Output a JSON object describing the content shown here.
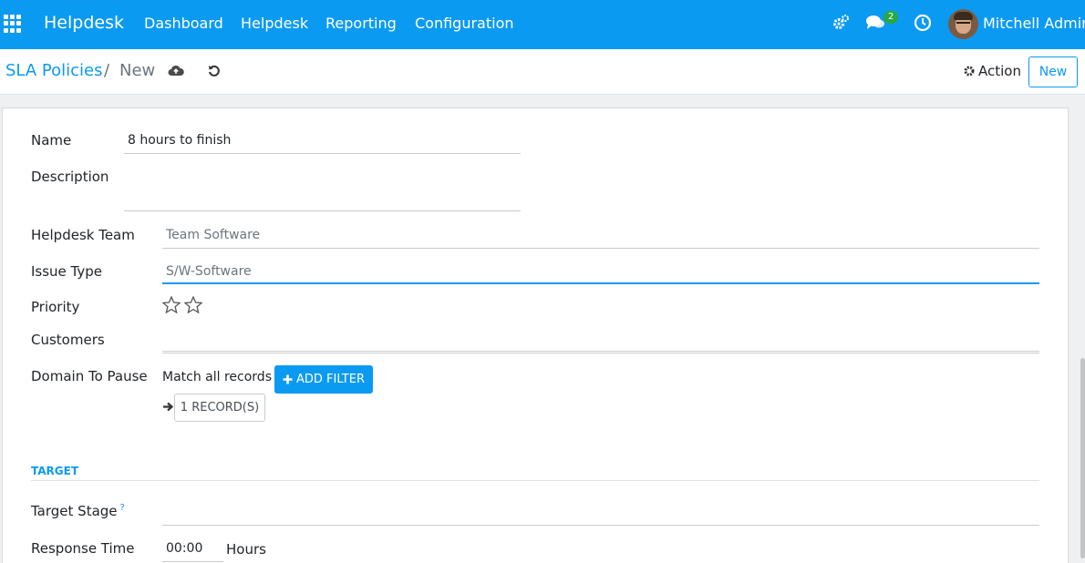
{
  "navbar": {
    "brand": "Helpdesk",
    "menu": [
      "Dashboard",
      "Helpdesk",
      "Reporting",
      "Configuration"
    ],
    "messages_count": "2",
    "user_name": "Mitchell Admin",
    "color": "#0b9af2"
  },
  "breadcrumb": {
    "parent": "SLA Policies",
    "separator": "/",
    "current": "New"
  },
  "control": {
    "action_label": "Action",
    "new_label": "New"
  },
  "form": {
    "name_label": "Name",
    "name_value": "8 hours to finish",
    "description_label": "Description",
    "description_value": "",
    "team_label": "Helpdesk Team",
    "team_value": "Team Software",
    "issue_type_label": "Issue Type",
    "issue_type_value": "S/W-Software",
    "priority_label": "Priority",
    "priority_stars_filled": 0,
    "priority_stars_total": 2,
    "customers_label": "Customers",
    "customers_value": "",
    "domain_label": "Domain To Pause",
    "domain_text": "Match all records",
    "add_filter_label": "ADD FILTER",
    "records_label": "1 RECORD(S)",
    "target_section": "TARGET",
    "target_stage_label": "Target Stage",
    "target_stage_help": "?",
    "target_stage_value": "",
    "response_time_label": "Response Time",
    "response_time_value": "00:00",
    "response_time_unit": "Hours"
  }
}
